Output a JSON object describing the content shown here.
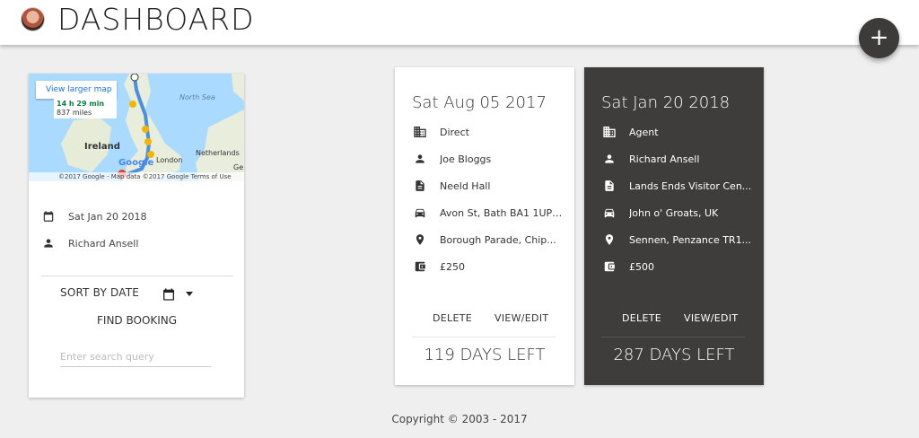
{
  "header": {
    "title": "DASHBOARD",
    "fab_label": "+"
  },
  "left_card": {
    "map": {
      "view_larger": "View larger map",
      "route_time": "14 h 29 min",
      "route_distance": "837 miles",
      "labels": {
        "north_sea": "North Sea",
        "ireland": "Ireland",
        "london": "London",
        "netherlands": "Netherlands",
        "ge": "Ge",
        "google": "Google"
      },
      "attribution": "©2017 Google - Map data ©2017 Google   Terms of Use"
    },
    "date": "Sat Jan 20 2018",
    "name": "Richard Ansell",
    "sort_label": "SORT BY DATE",
    "find_label": "FIND BOOKING",
    "search_placeholder": "Enter search query"
  },
  "bookings": [
    {
      "date": "Sat Aug 05 2017",
      "type": "Direct",
      "person": "Joe Bloggs",
      "document": "Neeld Hall",
      "pickup": "Avon St, Bath BA1 1UP,...",
      "destination": "Borough Parade, Chip...",
      "price": "£250",
      "delete": "DELETE",
      "edit": "VIEW/EDIT",
      "days_left": "119 DAYS LEFT"
    },
    {
      "date": "Sat Jan 20 2018",
      "type": "Agent",
      "person": "Richard Ansell",
      "document": "Lands Ends Visitor Cen...",
      "pickup": "John o' Groats, UK",
      "destination": "Sennen, Penzance TR1...",
      "price": "£500",
      "delete": "DELETE",
      "edit": "VIEW/EDIT",
      "days_left": "287 DAYS LEFT"
    }
  ],
  "footer": {
    "copyright": "Copyright © 2003 - 2017"
  },
  "colors": {
    "dark_card": "#3e3d3c",
    "fab": "#3c3b3a",
    "background": "#efefef"
  },
  "icons": [
    "calendar-icon",
    "person-icon",
    "building-icon",
    "document-icon",
    "car-icon",
    "location-pin-icon",
    "wallet-icon",
    "plus-icon",
    "caret-down-icon"
  ]
}
